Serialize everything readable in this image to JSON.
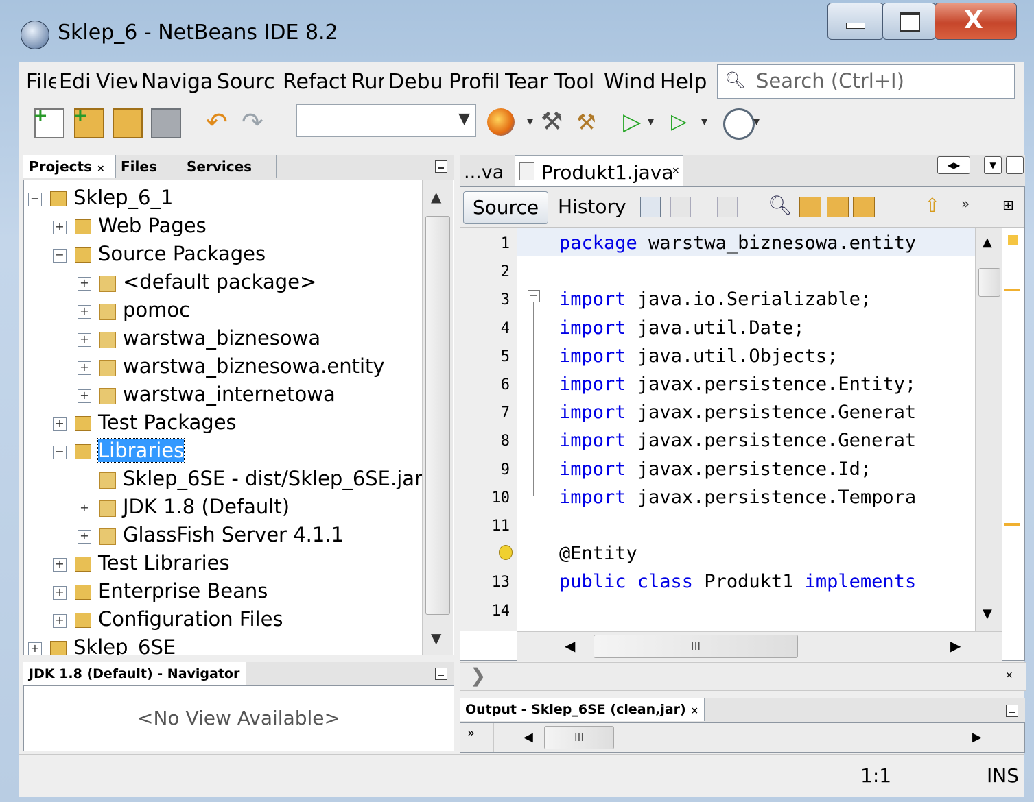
{
  "window": {
    "title": "Sklep_6 - NetBeans IDE 8.2"
  },
  "menu": [
    "File",
    "Edit",
    "View",
    "Navigate",
    "Source",
    "Refactor",
    "Run",
    "Debug",
    "Profile",
    "Team",
    "Tools",
    "Window",
    "Help"
  ],
  "menu_visible": [
    "Filе",
    "Edi",
    "Viev",
    "Naviga",
    "Sourc",
    "Refactе",
    "Rur",
    "Debu",
    "Profil",
    "Tear",
    "Tool",
    "Windo",
    "Helр"
  ],
  "search": {
    "placeholder": "Search (Ctrl+I)"
  },
  "projects_panel": {
    "tabs": [
      "Projects",
      "Files",
      "Services"
    ],
    "tree": [
      {
        "label": "Sklep_6_1",
        "level": 0,
        "expander": "minus"
      },
      {
        "label": "Web Pages",
        "level": 1,
        "expander": "plus"
      },
      {
        "label": "Source Packages",
        "level": 1,
        "expander": "minus"
      },
      {
        "label": "<default package>",
        "level": 2,
        "expander": "plus"
      },
      {
        "label": "pomoc",
        "level": 2,
        "expander": "plus"
      },
      {
        "label": "warstwa_biznesowa",
        "level": 2,
        "expander": "plus"
      },
      {
        "label": "warstwa_biznesowa.entity",
        "level": 2,
        "expander": "plus"
      },
      {
        "label": "warstwa_internetowa",
        "level": 2,
        "expander": "plus"
      },
      {
        "label": "Test Packages",
        "level": 1,
        "expander": "plus"
      },
      {
        "label": "Libraries",
        "level": 1,
        "expander": "minus",
        "selected": true
      },
      {
        "label": "Sklep_6SE - dist/Sklep_6SE.jar",
        "level": 2,
        "expander": "none"
      },
      {
        "label": "JDK 1.8 (Default)",
        "level": 2,
        "expander": "plus"
      },
      {
        "label": "GlassFish Server 4.1.1",
        "level": 2,
        "expander": "plus"
      },
      {
        "label": "Test Libraries",
        "level": 1,
        "expander": "plus"
      },
      {
        "label": "Enterprise Beans",
        "level": 1,
        "expander": "plus"
      },
      {
        "label": "Configuration Files",
        "level": 1,
        "expander": "plus"
      },
      {
        "label": "Sklep_6SE",
        "level": 0,
        "expander": "plus"
      }
    ]
  },
  "navigator": {
    "title": "JDK 1.8 (Default) - Navigator",
    "empty": "<No View Available>"
  },
  "editor": {
    "tab_prev": "...va",
    "tab_active": "Produkt1.java",
    "source_btn": "Source",
    "history_btn": "History",
    "lines": [
      {
        "n": "1",
        "parts": [
          [
            "kw",
            "package"
          ],
          [
            "",
            "  warstwa_biznesowa.entity"
          ]
        ]
      },
      {
        "n": "2",
        "parts": []
      },
      {
        "n": "3",
        "parts": [
          [
            "kw",
            "import"
          ],
          [
            "",
            "  java.io.Serializable;"
          ]
        ]
      },
      {
        "n": "4",
        "parts": [
          [
            "kw",
            "import"
          ],
          [
            "",
            "  java.util.Date;"
          ]
        ]
      },
      {
        "n": "5",
        "parts": [
          [
            "kw",
            "import"
          ],
          [
            "",
            "  java.util.Objects;"
          ]
        ]
      },
      {
        "n": "6",
        "parts": [
          [
            "kw",
            "import"
          ],
          [
            "",
            "  javax.persistence.Entity;"
          ]
        ]
      },
      {
        "n": "7",
        "parts": [
          [
            "kw",
            "import"
          ],
          [
            "",
            "  javax.persistence.Generat"
          ]
        ]
      },
      {
        "n": "8",
        "parts": [
          [
            "kw",
            "import"
          ],
          [
            "",
            "  javax.persistence.Generat"
          ]
        ]
      },
      {
        "n": "9",
        "parts": [
          [
            "kw",
            "import"
          ],
          [
            "",
            "  javax.persistence.Id;"
          ]
        ]
      },
      {
        "n": "10",
        "parts": [
          [
            "kw",
            "import"
          ],
          [
            "",
            "  javax.persistence.Tempora"
          ]
        ]
      },
      {
        "n": "11",
        "parts": []
      },
      {
        "n": "",
        "parts": [
          [
            "",
            "@Entity"
          ]
        ]
      },
      {
        "n": "13",
        "parts": [
          [
            "kw",
            "public class"
          ],
          [
            "",
            " Produkt1 "
          ],
          [
            "kw",
            "implements"
          ]
        ]
      },
      {
        "n": "14",
        "parts": []
      }
    ]
  },
  "output": {
    "title": "Output - Sklep_6SE (clean,jar)"
  },
  "statusbar": {
    "position": "1:1",
    "mode": "INS"
  }
}
